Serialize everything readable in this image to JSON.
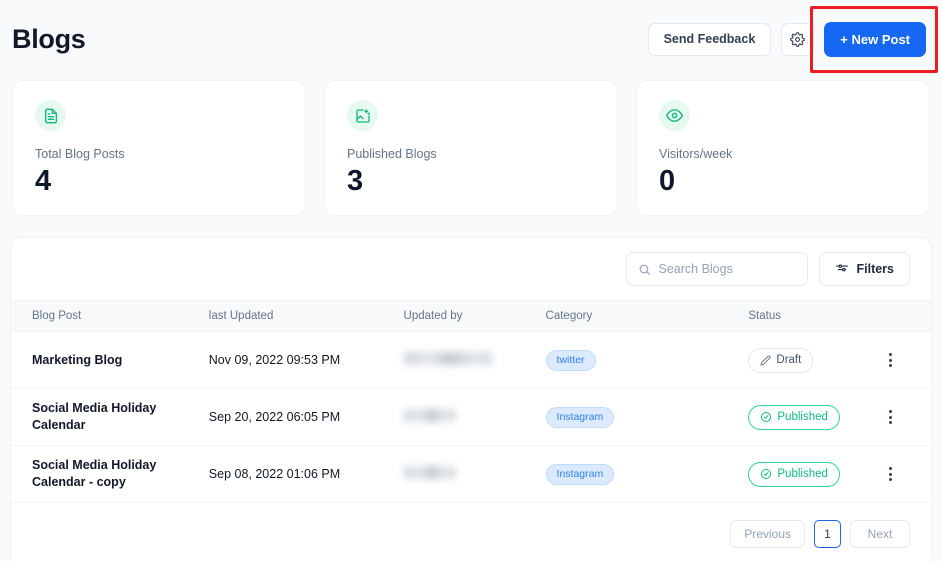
{
  "header": {
    "title": "Blogs",
    "send_feedback_label": "Send Feedback",
    "settings_icon": "gear-icon",
    "new_post_label": "+ New Post",
    "new_post_accent": "#1767f5",
    "highlight_color": "#ed1c24"
  },
  "stats": [
    {
      "icon": "document-icon",
      "label": "Total Blog Posts",
      "value": "4",
      "accent": "#10b981"
    },
    {
      "icon": "image-publish-icon",
      "label": "Published Blogs",
      "value": "3",
      "accent": "#10b981"
    },
    {
      "icon": "eye-icon",
      "label": "Visitors/week",
      "value": "0",
      "accent": "#10b981"
    }
  ],
  "toolbar": {
    "search_placeholder": "Search Blogs",
    "search_value": "",
    "search_icon": "search-icon",
    "filters_label": "Filters",
    "filters_icon": "filter-icon"
  },
  "table": {
    "columns": [
      "Blog Post",
      "last Updated",
      "Updated by",
      "Category",
      "Status",
      ""
    ],
    "rows": [
      {
        "post": "Marketing Blog",
        "updated": "Nov 09, 2022 09:53 PM",
        "updated_by": "",
        "updated_by_redacted": true,
        "updated_by_width": 88,
        "category": "twitter",
        "status": "Draft",
        "status_type": "draft",
        "status_icon": "pencil-icon",
        "menu_icon": "kebab-menu-icon"
      },
      {
        "post": "Social Media Holiday Calendar",
        "updated": "Sep 20, 2022 06:05 PM",
        "updated_by": "",
        "updated_by_redacted": true,
        "updated_by_width": 52,
        "category": "Instagram",
        "status": "Published",
        "status_type": "published",
        "status_icon": "check-circle-icon",
        "menu_icon": "kebab-menu-icon"
      },
      {
        "post": "Social Media Holiday Calendar - copy",
        "updated": "Sep 08, 2022 01:06 PM",
        "updated_by": "",
        "updated_by_redacted": true,
        "updated_by_width": 52,
        "category": "Instagram",
        "status": "Published",
        "status_type": "published",
        "status_icon": "check-circle-icon",
        "menu_icon": "kebab-menu-icon"
      }
    ]
  },
  "pagination": {
    "previous_label": "Previous",
    "current_page": "1",
    "next_label": "Next"
  }
}
